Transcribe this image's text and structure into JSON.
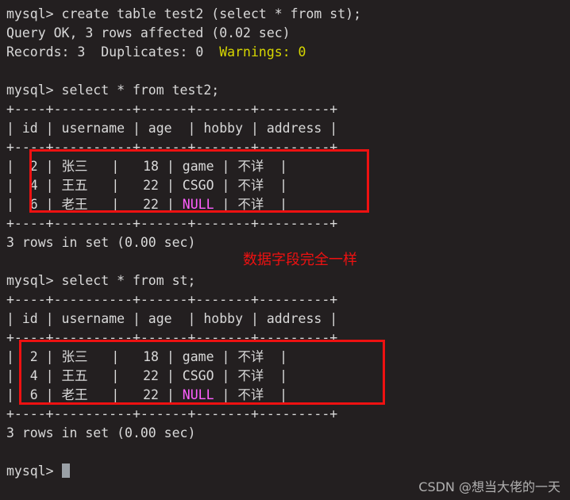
{
  "terminal": {
    "app": "mysql-client-terminal",
    "background_color": "#231f20",
    "foreground_color": "#d9d9d9",
    "prompt": "mysql> ",
    "lines": {
      "cmd_create": "mysql> create table test2 (select * from st);",
      "query_ok": "Query OK, 3 rows affected (0.02 sec)",
      "records_prefix": "Records: 3  Duplicates: 0  ",
      "records_warnings": "Warnings: 0",
      "cmd_select_test2": "mysql> select * from test2;",
      "cmd_select_st": "mysql> select * from st;",
      "rows_in_set_1": "3 rows in set (0.00 sec)",
      "rows_in_set_2": "3 rows in set (0.00 sec)",
      "final_prompt": "mysql> "
    },
    "separator": "+----+----------+------+-------+---------+",
    "header_row": "| id | username | age  | hobby | address |",
    "result_rows": [
      {
        "id": "|  2 | ",
        "username": "张三",
        "pad_user": "   | ",
        "age": "  18 | ",
        "hobby": "game ",
        "hobby_class": "normal",
        "mid": "| ",
        "address": "不详",
        "tail": "  |"
      },
      {
        "id": "|  4 | ",
        "username": "王五",
        "pad_user": "   | ",
        "age": "  22 | ",
        "hobby": "CSGO ",
        "hobby_class": "normal",
        "mid": "| ",
        "address": "不详",
        "tail": "  |"
      },
      {
        "id": "|  6 | ",
        "username": "老王",
        "pad_user": "   | ",
        "age": "  22 | ",
        "hobby": "NULL ",
        "hobby_class": "magenta",
        "mid": "| ",
        "address": "不详",
        "tail": "  |"
      }
    ],
    "annotation": {
      "text": "数据字段完全一样",
      "color": "#ee1111"
    },
    "highlight_boxes": {
      "color": "#ee1111",
      "count": 2
    },
    "watermark": "CSDN @想当大佬的一天"
  }
}
